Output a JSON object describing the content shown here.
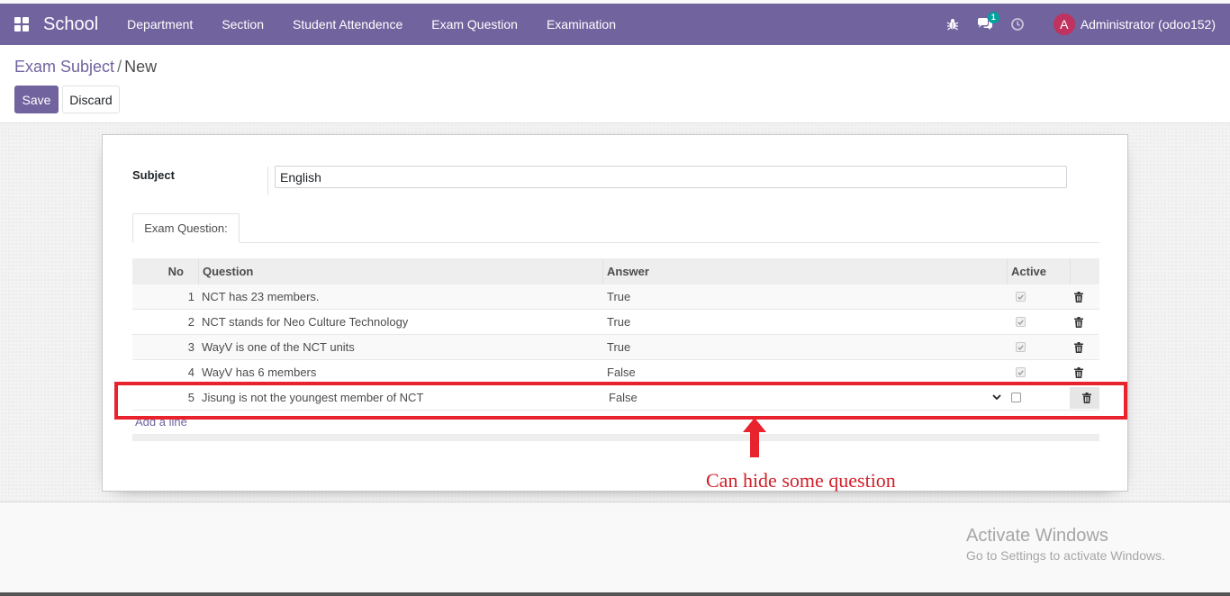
{
  "navbar": {
    "brand": "School",
    "menu": [
      "Department",
      "Section",
      "Student Attendence",
      "Exam Question",
      "Examination"
    ],
    "chat_badge": "1",
    "avatar_letter": "A",
    "user": "Administrator (odoo152)",
    "color": "#71639e"
  },
  "breadcrumb": {
    "parent": "Exam Subject",
    "separator": "/",
    "current": "New"
  },
  "buttons": {
    "save": "Save",
    "discard": "Discard"
  },
  "form": {
    "subject_label": "Subject",
    "subject_value": "English",
    "tab_label": "Exam Question:",
    "columns": {
      "no": "No",
      "question": "Question",
      "answer": "Answer",
      "active": "Active"
    },
    "rows": [
      {
        "no": "1",
        "question": "NCT has 23 members.",
        "answer": "True",
        "active": true
      },
      {
        "no": "2",
        "question": "NCT stands for Neo Culture Technology",
        "answer": "True",
        "active": true
      },
      {
        "no": "3",
        "question": "WayV is one of the NCT units",
        "answer": "True",
        "active": true
      },
      {
        "no": "4",
        "question": "WayV has 6 members",
        "answer": "False",
        "active": true
      },
      {
        "no": "5",
        "question": "Jisung is not the youngest member of NCT",
        "answer": "False",
        "active": false
      }
    ],
    "add_line": "Add a line"
  },
  "annotation": {
    "text": "Can hide some question",
    "color": "#e8232e"
  },
  "watermark": {
    "title": "Activate Windows",
    "subtitle": "Go to Settings to activate Windows."
  }
}
